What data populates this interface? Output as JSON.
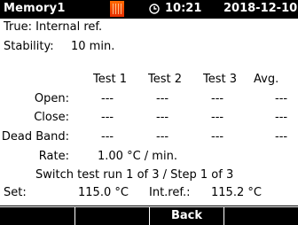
{
  "status_bar": {
    "title": "Memory1",
    "time": "10:21",
    "date": "2018-12-10",
    "heater_icon": "heater-icon",
    "clock_icon": "clock-icon",
    "colors": {
      "bar": "#000000",
      "heater": "#f05a00"
    }
  },
  "info": {
    "true_line": "True: Internal ref.",
    "stability_label": "Stability:",
    "stability_value": "10 min."
  },
  "table": {
    "columns": [
      "Test 1",
      "Test 2",
      "Test 3",
      "Avg."
    ],
    "rows": [
      {
        "label": "Open:",
        "values": [
          "---",
          "---",
          "---",
          "---"
        ]
      },
      {
        "label": "Close:",
        "values": [
          "---",
          "---",
          "---",
          "---"
        ]
      },
      {
        "label": "Dead Band:",
        "values": [
          "---",
          "---",
          "---",
          "---"
        ]
      }
    ]
  },
  "rate": {
    "label": "Rate:",
    "value": "1.00 °C / min."
  },
  "switch_line": "Switch test run 1 of 3 / Step 1 of 3",
  "setpoint": {
    "set_label": "Set:",
    "set_value": "115.0 °C",
    "intref_label": "Int.ref.:",
    "intref_value": "115.2 °C"
  },
  "softkeys": [
    "",
    "",
    "Back",
    ""
  ]
}
